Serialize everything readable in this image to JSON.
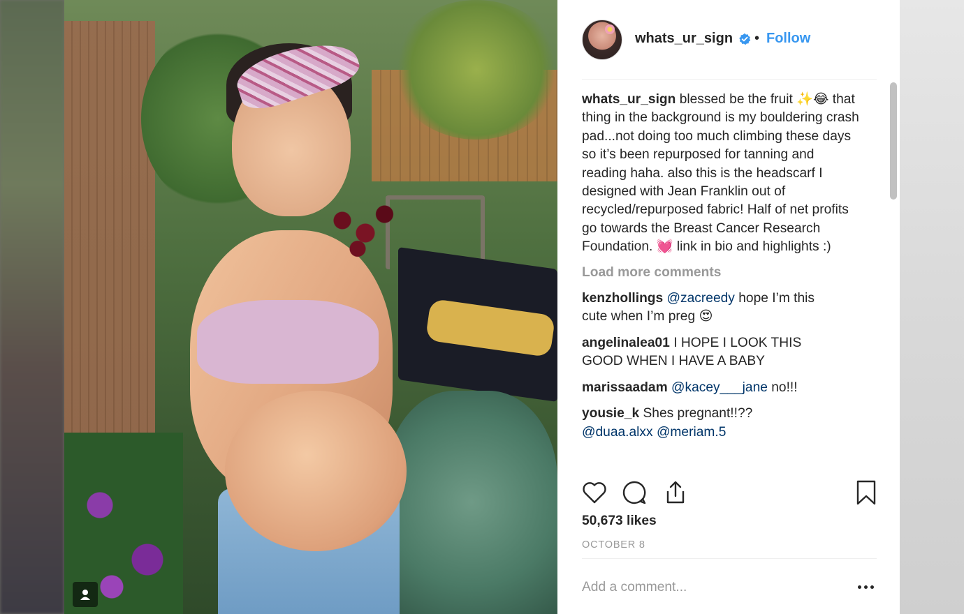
{
  "post": {
    "username": "whats_ur_sign",
    "separator": "•",
    "follow_label": "Follow",
    "caption_user": "whats_ur_sign",
    "caption_text": "blessed be the fruit ✨😂 that thing in the background is my bouldering crash pad...not doing too much climbing these days so it’s been repurposed for tanning and reading haha. also this is the headscarf I designed with Jean Franklin out of recycled/repurposed fabric! Half of net profits go towards the Breast Cancer Research Foundation. 💓 link in bio and highlights :)",
    "load_more_label": "Load more comments",
    "likes": "50,673 likes",
    "date": "OCTOBER 8",
    "add_comment_placeholder": "Add a comment..."
  },
  "comments": [
    {
      "user": "kenzhollings",
      "mention": "@zacreedy",
      "text": " hope I’m this cute when I’m preg 😍"
    },
    {
      "user": "angelinalea01",
      "mention": "",
      "text": " I HOPE I LOOK THIS GOOD WHEN I HAVE A BABY"
    },
    {
      "user": "marissaadam",
      "mention": "@kacey___jane",
      "text": " no!!!"
    },
    {
      "user": "yousie_k",
      "mention": "",
      "text": " Shes pregnant!!??"
    },
    {
      "user": "",
      "mention": "@duaa.alxx @meriam.5",
      "text": ""
    }
  ],
  "icons": {
    "verified": "verified-badge-icon",
    "like": "heart-icon",
    "comment": "speech-bubble-icon",
    "share": "share-icon",
    "save": "bookmark-icon",
    "more": "more-options-icon",
    "tagged_user": "user-tag-icon"
  },
  "colors": {
    "link_blue": "#3897f0",
    "mention_blue": "#003569",
    "muted_gray": "#999999",
    "text": "#262626"
  }
}
